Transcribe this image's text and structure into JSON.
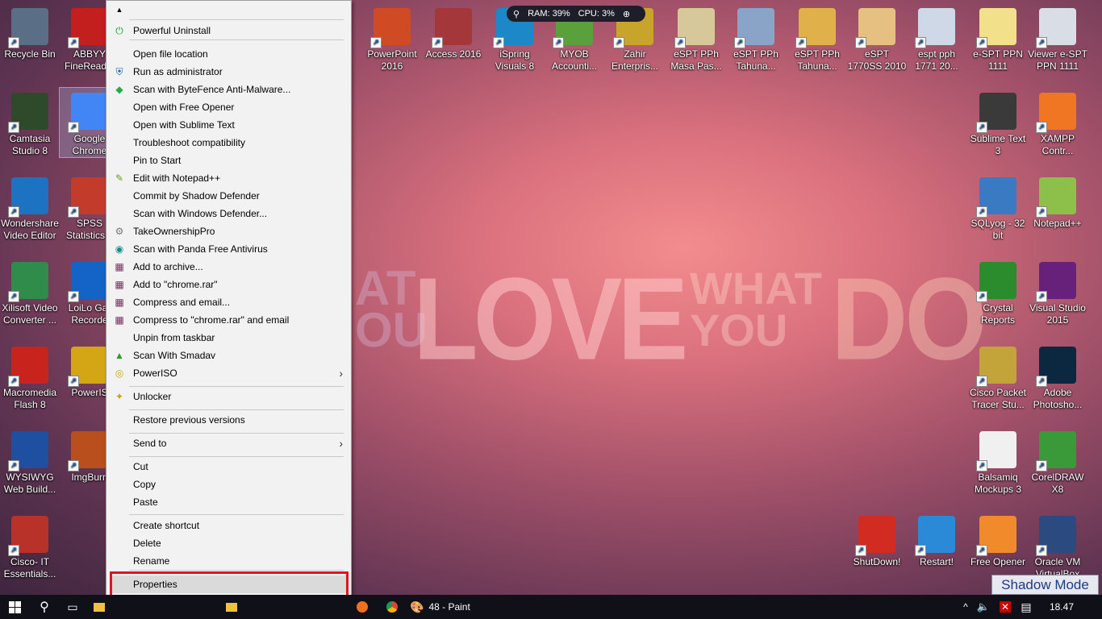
{
  "wallpaper": {
    "love": "LOVE",
    "at": "AT\nOU",
    "what": "WHAT\nYOU",
    "do": "DO"
  },
  "perf": {
    "ram": "RAM: 39%",
    "cpu": "CPU: 3%"
  },
  "desktop_icons": [
    {
      "label": "Recycle Bin",
      "color": "#5a6f86"
    },
    {
      "label": "ABBYY FineRead...",
      "color": "#c41f1f"
    },
    {
      "label": "Camtasia Studio 8",
      "color": "#2e4a2a"
    },
    {
      "label": "Google Chrome",
      "color": "#4285f4"
    },
    {
      "label": "Wondershare Video Editor",
      "color": "#1d72c2"
    },
    {
      "label": "SPSS Statistics 1",
      "color": "#c23b2b"
    },
    {
      "label": "Xilisoft Video Converter ...",
      "color": "#2f8c4b"
    },
    {
      "label": "LoiLo Gar Recorde",
      "color": "#1463c6"
    },
    {
      "label": "Macromedia Flash 8",
      "color": "#c8241d"
    },
    {
      "label": "PowerIS",
      "color": "#d4a515"
    },
    {
      "label": "WYSIWYG Web Build...",
      "color": "#1f4fa0"
    },
    {
      "label": "ImgBurn",
      "color": "#b94f1c"
    },
    {
      "label": "Cisco- IT Essentials...",
      "color": "#b8322a"
    },
    {
      "label": "PowerPoint 2016",
      "color": "#d04a24"
    },
    {
      "label": "Access 2016",
      "color": "#a4373a"
    },
    {
      "label": "iSpring Visuals 8",
      "color": "#1c88c8"
    },
    {
      "label": "MYOB Accounti...",
      "color": "#5aa03c"
    },
    {
      "label": "Zahir Enterpris...",
      "color": "#c9a42a"
    },
    {
      "label": "eSPT PPh Masa Pas...",
      "color": "#d6c89a"
    },
    {
      "label": "eSPT PPh Tahuna...",
      "color": "#8aa4c8"
    },
    {
      "label": "eSPT PPh Tahuna...",
      "color": "#e0b04a"
    },
    {
      "label": "eSPT 1770SS 2010",
      "color": "#e6c080"
    },
    {
      "label": "espt pph 1771 20...",
      "color": "#cfd8e6"
    },
    {
      "label": "e-SPT PPN 1111",
      "color": "#f2e08a"
    },
    {
      "label": "Viewer e-SPT PPN 1111",
      "color": "#d8dde6"
    },
    {
      "label": "Sublime Text 3",
      "color": "#3a3a3a"
    },
    {
      "label": "XAMPP Contr...",
      "color": "#f07623"
    },
    {
      "label": "SQLyog - 32 bit",
      "color": "#3a7ac2"
    },
    {
      "label": "Notepad++",
      "color": "#8cc04a"
    },
    {
      "label": "Crystal Reports",
      "color": "#2b8c2e"
    },
    {
      "label": "Visual Studio 2015",
      "color": "#68217a"
    },
    {
      "label": "Cisco Packet Tracer Stu...",
      "color": "#c2a43a"
    },
    {
      "label": "Adobe Photosho...",
      "color": "#0c2840"
    },
    {
      "label": "Balsamiq Mockups 3",
      "color": "#f0f0f0"
    },
    {
      "label": "CorelDRAW X8",
      "color": "#3a9a3a"
    },
    {
      "label": "ShutDown!",
      "color": "#d22c22"
    },
    {
      "label": "Restart!",
      "color": "#2a8ad8"
    },
    {
      "label": "Free Opener",
      "color": "#f08a2a"
    },
    {
      "label": "Oracle VM VirtualBox",
      "color": "#2a4a80"
    }
  ],
  "context_menu": {
    "items": [
      {
        "label": "Powerful Uninstall",
        "icon": "uninstall-icon"
      },
      {
        "label": "Open file location",
        "icon": ""
      },
      {
        "label": "Run as administrator",
        "icon": "shield-icon"
      },
      {
        "label": "Scan with ByteFence Anti-Malware...",
        "icon": "bytefence-icon"
      },
      {
        "label": "Open with Free Opener",
        "icon": ""
      },
      {
        "label": "Open with Sublime Text",
        "icon": ""
      },
      {
        "label": "Troubleshoot compatibility",
        "icon": ""
      },
      {
        "label": "Pin to Start",
        "icon": ""
      },
      {
        "label": "Edit with Notepad++",
        "icon": "notepadpp-icon"
      },
      {
        "label": "Commit by Shadow Defender",
        "icon": ""
      },
      {
        "label": "Scan with Windows Defender...",
        "icon": ""
      },
      {
        "label": "TakeOwnershipPro",
        "icon": "gear-icon"
      },
      {
        "label": "Scan with Panda Free Antivirus",
        "icon": "panda-icon"
      },
      {
        "label": "Add to archive...",
        "icon": "winrar-icon"
      },
      {
        "label": "Add to \"chrome.rar\"",
        "icon": "winrar-icon"
      },
      {
        "label": "Compress and email...",
        "icon": "winrar-icon"
      },
      {
        "label": "Compress to \"chrome.rar\" and email",
        "icon": "winrar-icon"
      },
      {
        "label": "Unpin from taskbar",
        "icon": ""
      },
      {
        "label": "Scan With Smadav",
        "icon": "smadav-icon"
      },
      {
        "label": "PowerISO",
        "icon": "poweriso-icon"
      },
      {
        "label": "Unlocker",
        "icon": "wand-icon"
      },
      {
        "label": "Restore previous versions",
        "icon": ""
      },
      {
        "label": "Send to",
        "icon": ""
      },
      {
        "label": "Cut",
        "icon": ""
      },
      {
        "label": "Copy",
        "icon": ""
      },
      {
        "label": "Paste",
        "icon": ""
      },
      {
        "label": "Create shortcut",
        "icon": ""
      },
      {
        "label": "Delete",
        "icon": ""
      },
      {
        "label": "Rename",
        "icon": ""
      },
      {
        "label": "Properties",
        "icon": ""
      }
    ]
  },
  "shadow_mode": "Shadow Mode",
  "taskbar": {
    "paint_label": "48 - Paint",
    "clock": "18.47"
  },
  "colors": {
    "highlight_border": "#e0141e",
    "menu_bg": "#f2f2f2",
    "taskbar_bg": "#101018"
  }
}
